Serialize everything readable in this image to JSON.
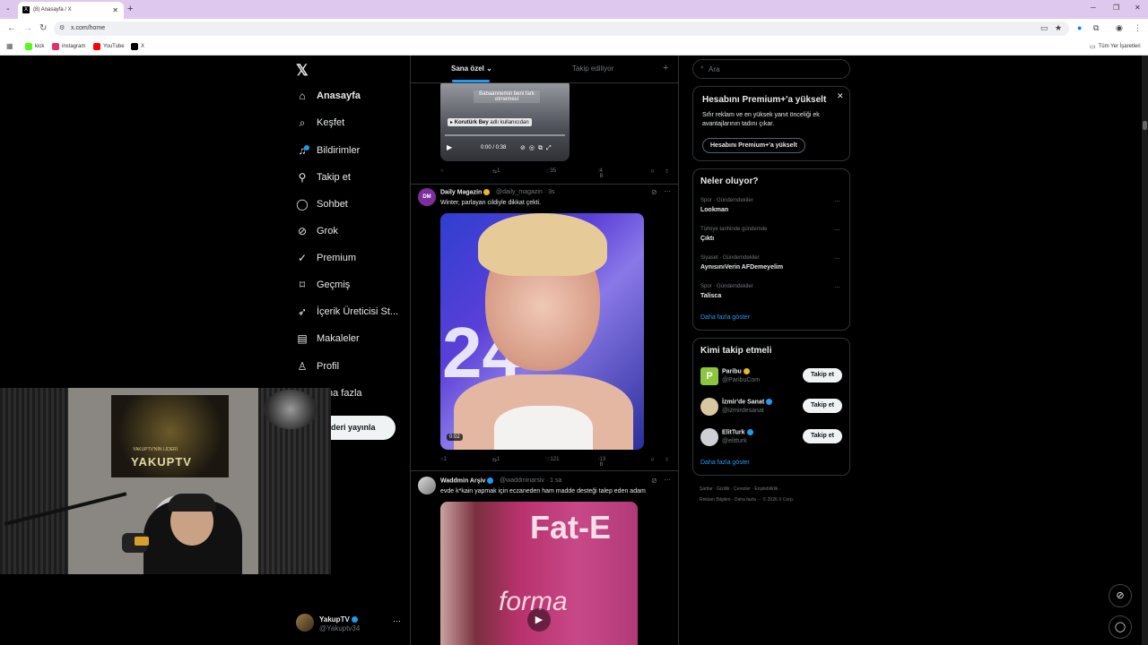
{
  "browser": {
    "tab_title": "(8) Anasayfa / X",
    "url": "x.com/home",
    "bookmarks": [
      {
        "label": "kick",
        "color": "#53fc18"
      },
      {
        "label": "instagram",
        "color": "#e1306c"
      },
      {
        "label": "YouTube",
        "color": "#ff0000"
      },
      {
        "label": "X",
        "color": "#000000"
      }
    ],
    "all_bookmarks_label": "Tüm Yer İşaretleri"
  },
  "nav": {
    "items": [
      {
        "label": "Anasayfa",
        "icon": "home-icon",
        "glyph": "⌂"
      },
      {
        "label": "Keşfet",
        "icon": "search-icon",
        "glyph": "⌕"
      },
      {
        "label": "Bildirimler",
        "icon": "bell-icon",
        "glyph": "🔔"
      },
      {
        "label": "Takip et",
        "icon": "follow-icon",
        "glyph": "👤"
      },
      {
        "label": "Sohbet",
        "icon": "chat-icon",
        "glyph": "◯"
      },
      {
        "label": "Grok",
        "icon": "grok-icon",
        "glyph": "⊘"
      },
      {
        "label": "Premium",
        "icon": "premium-icon",
        "glyph": "✓"
      },
      {
        "label": "Geçmiş",
        "icon": "bookmark-icon",
        "glyph": "🔖"
      },
      {
        "label": "İçerik Üreticisi St...",
        "icon": "rocket-icon",
        "glyph": "➶"
      },
      {
        "label": "Makaleler",
        "icon": "article-icon",
        "glyph": "▤"
      },
      {
        "label": "Profil",
        "icon": "profile-icon",
        "glyph": "👤"
      },
      {
        "label": "Daha fazla",
        "icon": "more-icon",
        "glyph": "⋯"
      }
    ],
    "post_button": "Gönderi yayınla",
    "visible_more": "ha fazla",
    "visible_post": "deri yayınla"
  },
  "account": {
    "name": "YakupTV",
    "handle": "@Yakuptv34"
  },
  "webcam": {
    "poster_text": "YAKUPTV",
    "poster_sub": "YAKUPTV'NİN LİDERİ"
  },
  "timeline": {
    "tabs": [
      "Sana özel",
      "Takip ediliyor"
    ],
    "tweet1": {
      "caption": "Babaannemin beni fark etmemesi",
      "overlay": "Korutürk Bey adlı kullanıcıdan",
      "overlay_name": "Korutürk Bey",
      "overlay_rest": " adlı kullanıcıdan",
      "time": "0:00 / 0:38",
      "replies": "",
      "retweets": "1",
      "likes": "35",
      "views": "4 B"
    },
    "tweet2": {
      "avatar_text": "DM",
      "name": "Daily Magazin",
      "handle": "@daily_magazin",
      "time": "3s",
      "text": "Winter, parlayan cildiyle dikkat çekti.",
      "duration": "0:02",
      "image_text": "24",
      "replies": "1",
      "retweets": "1",
      "likes": "121",
      "views": "13 B"
    },
    "tweet3": {
      "name": "Waddmin Arşiv",
      "handle": "@waddminarsiv",
      "time": "1 sa",
      "text": "evde k*kain yapmak için eczaneden ham madde desteği talep eden adam",
      "image_text1": "Fat-E",
      "image_text2": "forma"
    }
  },
  "sidebar": {
    "search_placeholder": "Ara",
    "premium": {
      "title": "Hesabını Premium+'a yükselt",
      "desc": "Sıfır reklam ve en yüksek yanıt önceliği ek avantajlarının tadını çıkar.",
      "button": "Hesabını Premium+'a yükselt"
    },
    "trends_title": "Neler oluyor?",
    "trends": [
      {
        "category": "Spor · Gündemdekiler",
        "name": "Lookman"
      },
      {
        "category": "Türkiye tarihinde gündemde",
        "name": "Çıktı"
      },
      {
        "category": "Siyaset · Gündemdekiler",
        "name": "AynısınıVerin AFDemeyelim"
      },
      {
        "category": "Spor · Gündemdekiler",
        "name": "Talisca"
      }
    ],
    "show_more": "Daha fazla göster",
    "who_title": "Kimi takip etmeli",
    "who": [
      {
        "name": "Paribu",
        "handle": "@ParibuCom",
        "badge": "gold",
        "color": "#8cc63f"
      },
      {
        "name": "İzmir'de Sanat",
        "handle": "@izmirdesanat",
        "badge": "blue",
        "color": "#d8c8a0"
      },
      {
        "name": "ElitTurk",
        "handle": "@elitturk",
        "badge": "blue",
        "color": "#cfcfd6"
      }
    ],
    "follow_label": "Takip et",
    "footer_line1": "Şartlar  ·  Gizlilik  ·  Çerezler  ·  Erişilebilirlik  ·",
    "footer_line2": "Reklam Bilgileri  ·  Daha fazla ···  © 2026 X Corp."
  }
}
